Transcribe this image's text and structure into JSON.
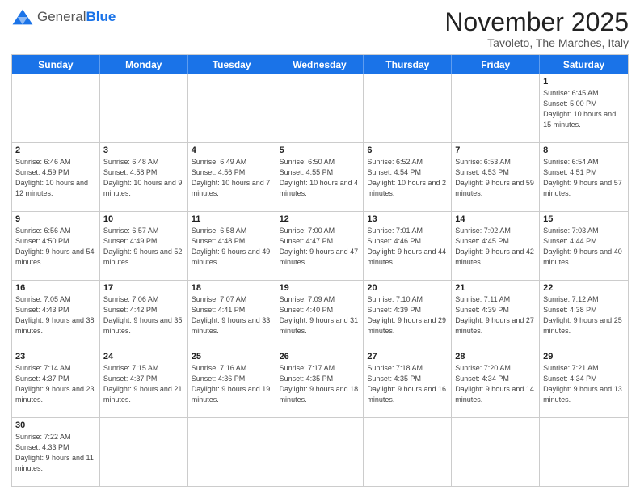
{
  "header": {
    "logo_general": "General",
    "logo_blue": "Blue",
    "month_title": "November 2025",
    "subtitle": "Tavoleto, The Marches, Italy"
  },
  "days_of_week": [
    "Sunday",
    "Monday",
    "Tuesday",
    "Wednesday",
    "Thursday",
    "Friday",
    "Saturday"
  ],
  "weeks": [
    [
      {
        "day": "",
        "info": ""
      },
      {
        "day": "",
        "info": ""
      },
      {
        "day": "",
        "info": ""
      },
      {
        "day": "",
        "info": ""
      },
      {
        "day": "",
        "info": ""
      },
      {
        "day": "",
        "info": ""
      },
      {
        "day": "1",
        "info": "Sunrise: 6:45 AM\nSunset: 5:00 PM\nDaylight: 10 hours\nand 15 minutes."
      }
    ],
    [
      {
        "day": "2",
        "info": "Sunrise: 6:46 AM\nSunset: 4:59 PM\nDaylight: 10 hours\nand 12 minutes."
      },
      {
        "day": "3",
        "info": "Sunrise: 6:48 AM\nSunset: 4:58 PM\nDaylight: 10 hours\nand 9 minutes."
      },
      {
        "day": "4",
        "info": "Sunrise: 6:49 AM\nSunset: 4:56 PM\nDaylight: 10 hours\nand 7 minutes."
      },
      {
        "day": "5",
        "info": "Sunrise: 6:50 AM\nSunset: 4:55 PM\nDaylight: 10 hours\nand 4 minutes."
      },
      {
        "day": "6",
        "info": "Sunrise: 6:52 AM\nSunset: 4:54 PM\nDaylight: 10 hours\nand 2 minutes."
      },
      {
        "day": "7",
        "info": "Sunrise: 6:53 AM\nSunset: 4:53 PM\nDaylight: 9 hours\nand 59 minutes."
      },
      {
        "day": "8",
        "info": "Sunrise: 6:54 AM\nSunset: 4:51 PM\nDaylight: 9 hours\nand 57 minutes."
      }
    ],
    [
      {
        "day": "9",
        "info": "Sunrise: 6:56 AM\nSunset: 4:50 PM\nDaylight: 9 hours\nand 54 minutes."
      },
      {
        "day": "10",
        "info": "Sunrise: 6:57 AM\nSunset: 4:49 PM\nDaylight: 9 hours\nand 52 minutes."
      },
      {
        "day": "11",
        "info": "Sunrise: 6:58 AM\nSunset: 4:48 PM\nDaylight: 9 hours\nand 49 minutes."
      },
      {
        "day": "12",
        "info": "Sunrise: 7:00 AM\nSunset: 4:47 PM\nDaylight: 9 hours\nand 47 minutes."
      },
      {
        "day": "13",
        "info": "Sunrise: 7:01 AM\nSunset: 4:46 PM\nDaylight: 9 hours\nand 44 minutes."
      },
      {
        "day": "14",
        "info": "Sunrise: 7:02 AM\nSunset: 4:45 PM\nDaylight: 9 hours\nand 42 minutes."
      },
      {
        "day": "15",
        "info": "Sunrise: 7:03 AM\nSunset: 4:44 PM\nDaylight: 9 hours\nand 40 minutes."
      }
    ],
    [
      {
        "day": "16",
        "info": "Sunrise: 7:05 AM\nSunset: 4:43 PM\nDaylight: 9 hours\nand 38 minutes."
      },
      {
        "day": "17",
        "info": "Sunrise: 7:06 AM\nSunset: 4:42 PM\nDaylight: 9 hours\nand 35 minutes."
      },
      {
        "day": "18",
        "info": "Sunrise: 7:07 AM\nSunset: 4:41 PM\nDaylight: 9 hours\nand 33 minutes."
      },
      {
        "day": "19",
        "info": "Sunrise: 7:09 AM\nSunset: 4:40 PM\nDaylight: 9 hours\nand 31 minutes."
      },
      {
        "day": "20",
        "info": "Sunrise: 7:10 AM\nSunset: 4:39 PM\nDaylight: 9 hours\nand 29 minutes."
      },
      {
        "day": "21",
        "info": "Sunrise: 7:11 AM\nSunset: 4:39 PM\nDaylight: 9 hours\nand 27 minutes."
      },
      {
        "day": "22",
        "info": "Sunrise: 7:12 AM\nSunset: 4:38 PM\nDaylight: 9 hours\nand 25 minutes."
      }
    ],
    [
      {
        "day": "23",
        "info": "Sunrise: 7:14 AM\nSunset: 4:37 PM\nDaylight: 9 hours\nand 23 minutes."
      },
      {
        "day": "24",
        "info": "Sunrise: 7:15 AM\nSunset: 4:37 PM\nDaylight: 9 hours\nand 21 minutes."
      },
      {
        "day": "25",
        "info": "Sunrise: 7:16 AM\nSunset: 4:36 PM\nDaylight: 9 hours\nand 19 minutes."
      },
      {
        "day": "26",
        "info": "Sunrise: 7:17 AM\nSunset: 4:35 PM\nDaylight: 9 hours\nand 18 minutes."
      },
      {
        "day": "27",
        "info": "Sunrise: 7:18 AM\nSunset: 4:35 PM\nDaylight: 9 hours\nand 16 minutes."
      },
      {
        "day": "28",
        "info": "Sunrise: 7:20 AM\nSunset: 4:34 PM\nDaylight: 9 hours\nand 14 minutes."
      },
      {
        "day": "29",
        "info": "Sunrise: 7:21 AM\nSunset: 4:34 PM\nDaylight: 9 hours\nand 13 minutes."
      }
    ],
    [
      {
        "day": "30",
        "info": "Sunrise: 7:22 AM\nSunset: 4:33 PM\nDaylight: 9 hours\nand 11 minutes."
      },
      {
        "day": "",
        "info": ""
      },
      {
        "day": "",
        "info": ""
      },
      {
        "day": "",
        "info": ""
      },
      {
        "day": "",
        "info": ""
      },
      {
        "day": "",
        "info": ""
      },
      {
        "day": "",
        "info": ""
      }
    ]
  ]
}
